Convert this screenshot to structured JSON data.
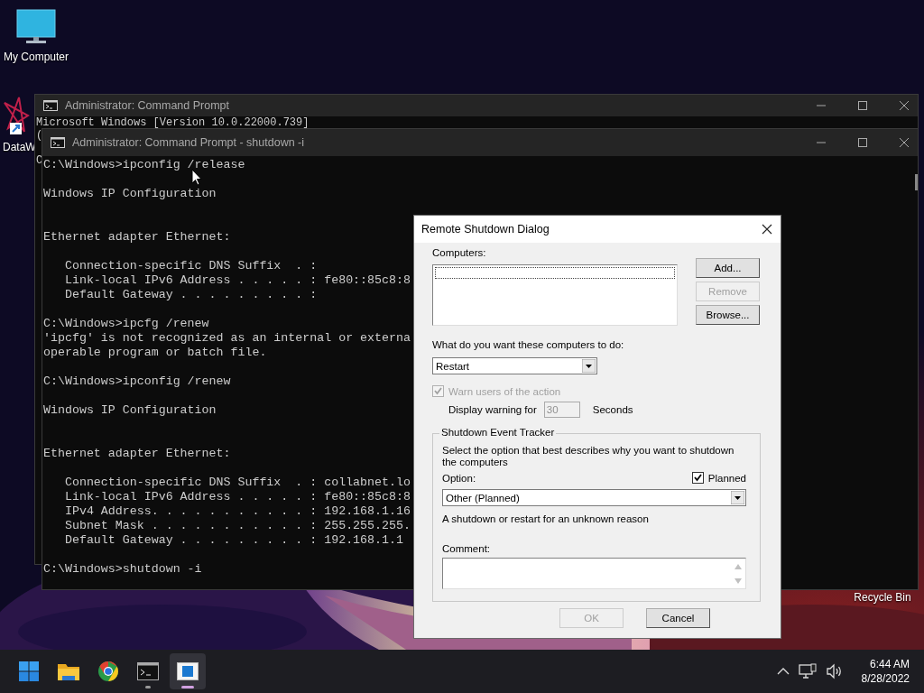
{
  "desktop": {
    "icons": [
      {
        "kind": "monitor",
        "label": "My Computer"
      },
      {
        "kind": "shortcut",
        "label": "DataW"
      },
      {
        "kind": "bin",
        "label": "Recycle Bin"
      }
    ]
  },
  "windows": [
    {
      "title": "Administrator: Command Prompt",
      "blocks": [
        {
          "kind": "plain",
          "lines": [
            "Microsoft Windows [Version 10.0.22000.739]",
            "("
          ]
        },
        {
          "kind": "plain",
          "lines": [
            "C"
          ]
        }
      ]
    },
    {
      "title": "Administrator: Command Prompt - shutdown  -i",
      "blocks": [
        {
          "kind": "plain",
          "lines": [
            "C:\\Windows>ipconfig /release"
          ]
        },
        {
          "kind": "header",
          "lines": [
            "Windows IP Configuration"
          ]
        },
        {
          "kind": "plain",
          "lines": [
            "Ethernet adapter Ethernet:"
          ]
        },
        {
          "kind": "plain",
          "lines": [
            "   Connection-specific DNS Suffix  . :",
            "   Link-local IPv6 Address . . . . . : fe80::85c8:8",
            "   Default Gateway . . . . . . . . . :"
          ]
        },
        {
          "kind": "plain",
          "lines": [
            "C:\\Windows>ipcfg /renew",
            "'ipcfg' is not recognized as an internal or externa",
            "operable program or batch file."
          ]
        },
        {
          "kind": "plain",
          "lines": [
            "C:\\Windows>ipconfig /renew"
          ]
        },
        {
          "kind": "header",
          "lines": [
            "Windows IP Configuration"
          ]
        },
        {
          "kind": "plain",
          "lines": [
            "Ethernet adapter Ethernet:"
          ]
        },
        {
          "kind": "plain",
          "lines": [
            "   Connection-specific DNS Suffix  . : collabnet.lo",
            "   Link-local IPv6 Address . . . . . : fe80::85c8:8",
            "   IPv4 Address. . . . . . . . . . . : 192.168.1.16",
            "   Subnet Mask . . . . . . . . . . . : 255.255.255.",
            "   Default Gateway . . . . . . . . . : 192.168.1.1"
          ]
        },
        {
          "kind": "plain",
          "lines": [
            "C:\\Windows>shutdown -i"
          ]
        }
      ]
    }
  ],
  "dialog": {
    "title": "Remote Shutdown Dialog",
    "computers_label": "Computers:",
    "side_buttons": [
      {
        "label": "Add...",
        "disabled": false
      },
      {
        "label": "Remove",
        "disabled": true
      },
      {
        "label": "Browse...",
        "disabled": false
      }
    ],
    "action_label": "What do you want these computers to do:",
    "action_value": "Restart",
    "warn": {
      "label": "Warn users of the action",
      "checked": true,
      "disabled": true
    },
    "warning_label": "Display warning for",
    "warning_value": "30",
    "warning_unit": "Seconds",
    "tracker": {
      "title": "Shutdown Event Tracker",
      "description": "Select the option that best describes why you want to shutdown the computers",
      "option_label": "Option:",
      "planned": {
        "label": "Planned",
        "checked": true,
        "disabled": false
      },
      "option_value": "Other (Planned)",
      "option_description": "A shutdown or restart for an unknown reason",
      "comment_label": "Comment:"
    },
    "buttons": [
      {
        "label": "OK",
        "disabled": true
      },
      {
        "label": "Cancel",
        "disabled": false
      }
    ]
  },
  "taskbar": {
    "apps": [
      {
        "kind": "start",
        "running": false,
        "selected": false
      },
      {
        "kind": "folder",
        "running": false,
        "selected": false
      },
      {
        "kind": "chrome",
        "running": false,
        "selected": false
      },
      {
        "kind": "terminal",
        "running": true,
        "selected": false
      },
      {
        "kind": "dialog",
        "running": true,
        "selected": true
      }
    ],
    "time": "6:44 AM",
    "date": "8/28/2022"
  }
}
